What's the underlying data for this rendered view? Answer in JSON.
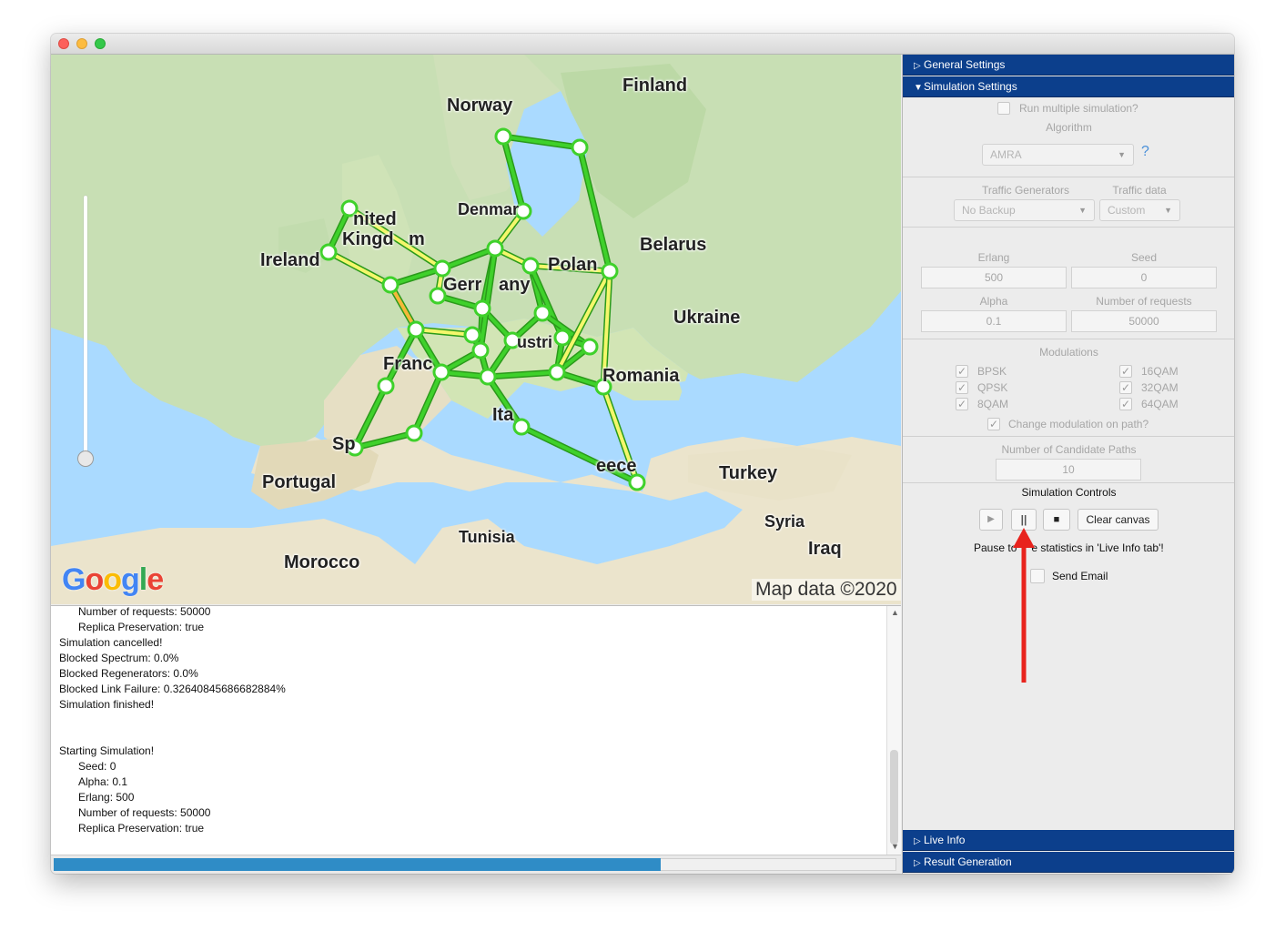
{
  "map": {
    "labels": [
      {
        "key": "finland",
        "text": "Finland"
      },
      {
        "key": "norway",
        "text": "Norway"
      },
      {
        "key": "denmark",
        "text": "Denmar"
      },
      {
        "key": "uk1",
        "text": "nited"
      },
      {
        "key": "uk2",
        "text": "Kingd"
      },
      {
        "key": "uk3",
        "text": "m"
      },
      {
        "key": "ireland",
        "text": "Ireland"
      },
      {
        "key": "germany1",
        "text": "Gerr"
      },
      {
        "key": "germany2",
        "text": "any"
      },
      {
        "key": "poland",
        "text": "Polan"
      },
      {
        "key": "belarus",
        "text": "Belarus"
      },
      {
        "key": "ukraine",
        "text": "Ukraine"
      },
      {
        "key": "france",
        "text": "Franc"
      },
      {
        "key": "austria",
        "text": "ustri"
      },
      {
        "key": "romania",
        "text": "Romania"
      },
      {
        "key": "italy",
        "text": "Ita"
      },
      {
        "key": "spain",
        "text": "Sp"
      },
      {
        "key": "portugal",
        "text": "Portugal"
      },
      {
        "key": "greece",
        "text": "eece"
      },
      {
        "key": "turkey",
        "text": "Turkey"
      },
      {
        "key": "syria",
        "text": "Syria"
      },
      {
        "key": "iraq",
        "text": "Iraq"
      },
      {
        "key": "tunisia",
        "text": "Tunisia"
      },
      {
        "key": "morocco",
        "text": "Morocco"
      }
    ],
    "google_logo": "Google",
    "attribution": "Map data ©2020"
  },
  "console": {
    "lines": [
      "Number of requests: 50000",
      "Replica Preservation: true",
      "Simulation cancelled!",
      "Blocked Spectrum: 0.0%",
      "Blocked Regenerators: 0.0%",
      "Blocked Link Failure: 0.32640845686682884%",
      "Simulation finished!",
      "",
      "",
      "Starting Simulation!",
      "Seed: 0",
      "Alpha: 0.1",
      "Erlang: 500",
      "Number of requests: 50000",
      "Replica Preservation: true"
    ]
  },
  "progress": {
    "value": 0.72
  },
  "panel": {
    "general_settings": "General Settings",
    "simulation_settings": "Simulation Settings",
    "run_multiple": "Run multiple simulation?",
    "algorithm_label": "Algorithm",
    "algorithm_value": "AMRA",
    "help": "?",
    "traffic_generators_label": "Traffic Generators",
    "traffic_generators_value": "No Backup",
    "traffic_data_label": "Traffic data",
    "traffic_data_value": "Custom",
    "erlang_label": "Erlang",
    "erlang_value": "500",
    "seed_label": "Seed",
    "seed_value": "0",
    "alpha_label": "Alpha",
    "alpha_value": "0.1",
    "requests_label": "Number of requests",
    "requests_value": "50000",
    "modulations_label": "Modulations",
    "modulations": [
      "BPSK",
      "QPSK",
      "8QAM",
      "16QAM",
      "32QAM",
      "64QAM"
    ],
    "change_modulation": "Change modulation on path?",
    "candidate_paths_label": "Number of Candidate Paths",
    "candidate_paths_value": "10",
    "controls_label": "Simulation Controls",
    "clear_canvas": "Clear canvas",
    "pause_hint_a": "Pause to",
    "pause_hint_b": "e statistics in 'Live Info tab'!",
    "send_email": "Send Email",
    "live_info": "Live Info",
    "result_generation": "Result Generation"
  },
  "colors": {
    "header_blue": "#0c3f8c",
    "link_green": "#3fd12b",
    "link_yellow": "#f4f76b",
    "progress": "#2f8cc6",
    "arrow": "#e8231d"
  }
}
